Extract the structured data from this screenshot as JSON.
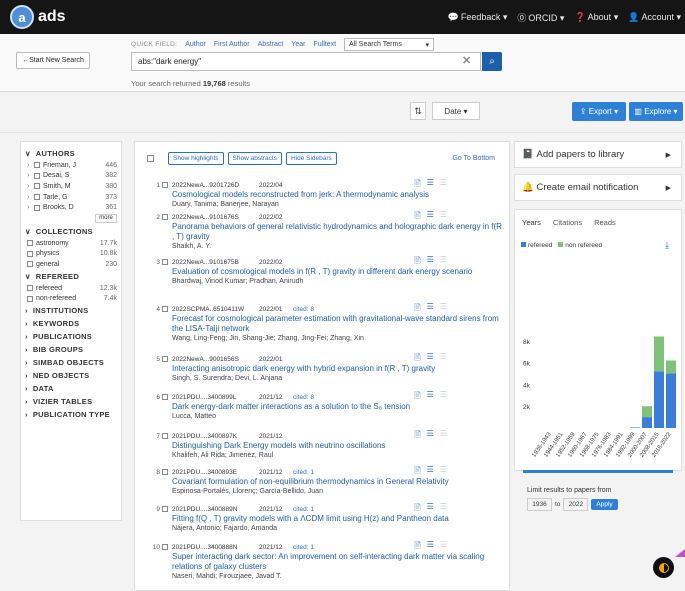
{
  "nav": {
    "logo_letter": "a",
    "logo": "ads",
    "feedback": "Feedback",
    "orcid": "ORCID",
    "about": "About",
    "account": "Account"
  },
  "search": {
    "start_new": "Start New Search",
    "quick_field_label": "QUICK FIELD:",
    "fields": [
      "Author",
      "First Author",
      "Abstract",
      "Year",
      "Fulltext"
    ],
    "terms_select": "All Search Terms",
    "query": "abs:\"dark energy\"",
    "results_prefix": "Your search returned",
    "results_count": "19,768",
    "results_suffix": "results"
  },
  "toolbar": {
    "sort": "Date",
    "export": "Export",
    "explore": "Explore"
  },
  "facets": {
    "authors_title": "AUTHORS",
    "authors": [
      {
        "name": "Frieman, J",
        "count": "446"
      },
      {
        "name": "Desai, S",
        "count": "382"
      },
      {
        "name": "Smith, M",
        "count": "380"
      },
      {
        "name": "Tarle, G",
        "count": "373"
      },
      {
        "name": "Brooks, D",
        "count": "361"
      }
    ],
    "more": "more",
    "collections_title": "COLLECTIONS",
    "collections": [
      {
        "name": "astronomy",
        "count": "17.7k"
      },
      {
        "name": "physics",
        "count": "10.8k"
      },
      {
        "name": "general",
        "count": "230"
      }
    ],
    "refereed_title": "REFEREED",
    "refereed": [
      {
        "name": "refereed",
        "count": "12.3k"
      },
      {
        "name": "non-refereed",
        "count": "7.4k"
      }
    ],
    "others": [
      "INSTITUTIONS",
      "KEYWORDS",
      "PUBLICATIONS",
      "BIB GROUPS",
      "SIMBAD OBJECTS",
      "NED OBJECTS",
      "DATA",
      "VIZIER TABLES",
      "PUBLICATION TYPE"
    ]
  },
  "list": {
    "show_highlights": "Show highlights",
    "show_abstracts": "Show abstracts",
    "hide_sidebars": "Hide Sidebars",
    "go_bottom": "Go To Bottom",
    "items": [
      {
        "num": "1",
        "bib": "2022NewA...9201726D",
        "date": "2022/04",
        "cited": "",
        "title": "Cosmological models reconstructed from jerk: A thermodynamic analysis",
        "authors": "Duary, Tanima; Banerjee, Narayan"
      },
      {
        "num": "2",
        "bib": "2022NewA...9101676S",
        "date": "2022/02",
        "cited": "",
        "title": "Panorama behaviors of general relativistic hydrodynamics and holographic dark energy in f(R , T) gravity",
        "authors": "Shaikh, A. Y."
      },
      {
        "num": "3",
        "bib": "2022NewA...9101675B",
        "date": "2022/02",
        "cited": "",
        "title": "Evaluation of cosmological models in f(R , T) gravity in different dark energy scenario",
        "authors": "Bhardwaj, Vinod Kumar; Pradhan, Anirudh"
      },
      {
        "num": "4",
        "bib": "2022SCPMA..6510411W",
        "date": "2022/01",
        "cited": "cited: 8",
        "title": "Forecast for cosmological parameter estimation with gravitational-wave standard sirens from the LISA-Taiji network",
        "authors": "Wang, Ling-Feng; Jin, Shang-Jie; Zhang, Jing-Fei; Zhang, Xin"
      },
      {
        "num": "5",
        "bib": "2022NewA...9001656S",
        "date": "2022/01",
        "cited": "",
        "title": "Interacting anisotropic dark energy with hybrid expansion in f(R , T) gravity",
        "authors": "Singh, S. Surendra; Devi, L. Anjana"
      },
      {
        "num": "6",
        "bib": "2021PDU....3400899L",
        "date": "2021/12",
        "cited": "cited: 8",
        "title": "Dark energy-dark matter interactions as a solution to the S₈ tension",
        "authors": "Lucca, Matteo"
      },
      {
        "num": "7",
        "bib": "2021PDU....3400897K",
        "date": "2021/12",
        "cited": "",
        "title": "Distinguishing Dark Energy models with neutrino oscillations",
        "authors": "Khalifeh, Ali Rida; Jimenez, Raul"
      },
      {
        "num": "8",
        "bib": "2021PDU....3400893E",
        "date": "2021/12",
        "cited": "cited: 1",
        "title": "Covariant formulation of non-equilibrium thermodynamics in General Relativity",
        "authors": "Espinosa-Portalés, Llorenç; García-Bellido, Juan"
      },
      {
        "num": "9",
        "bib": "2021PDU....3400889N",
        "date": "2021/12",
        "cited": "cited: 1",
        "title": "Fitting f(Q , T) gravity models with a ΛCDM limit using H(z) and Pantheon data",
        "authors": "Nájera, Antonio; Fajardo, Amanda"
      },
      {
        "num": "10",
        "bib": "2021PDU....3400888N",
        "date": "2021/12",
        "cited": "cited: 1",
        "title": "Super interacting dark sector: An improvement on self-interacting dark matter via scaling relations of galaxy clusters",
        "authors": "Naseri, Mahdi; Firouzjaee, Javad T."
      }
    ]
  },
  "side": {
    "add_library": "Add papers to library",
    "email_notif": "Create email notification",
    "tabs": [
      "Years",
      "Citations",
      "Reads"
    ],
    "legend_refereed": "refereed",
    "legend_nonref": "non refereed",
    "refereed_color": "#3b7dd8",
    "nonref_color": "#80c27a",
    "limit_text": "Limit results to papers from",
    "year_from": "1936",
    "year_to": "2022",
    "apply": "Apply"
  },
  "chart_data": {
    "type": "bar",
    "stacked": true,
    "categories": [
      "1936-1943",
      "1944-1951",
      "1952-1959",
      "1960-1967",
      "1968-1975",
      "1976-1983",
      "1984-1991",
      "1992-1999",
      "2000-2007",
      "2008-2015",
      "2016-2022"
    ],
    "series": [
      {
        "name": "refereed",
        "values": [
          0,
          0,
          0,
          0,
          0,
          0,
          0,
          50,
          1000,
          5200,
          5000
        ]
      },
      {
        "name": "non refereed",
        "values": [
          0,
          0,
          0,
          0,
          0,
          0,
          0,
          0,
          1000,
          3200,
          1200
        ]
      }
    ],
    "yticks": [
      "8k",
      "6k",
      "4k",
      "2k"
    ],
    "ylim": [
      0,
      9000
    ]
  }
}
